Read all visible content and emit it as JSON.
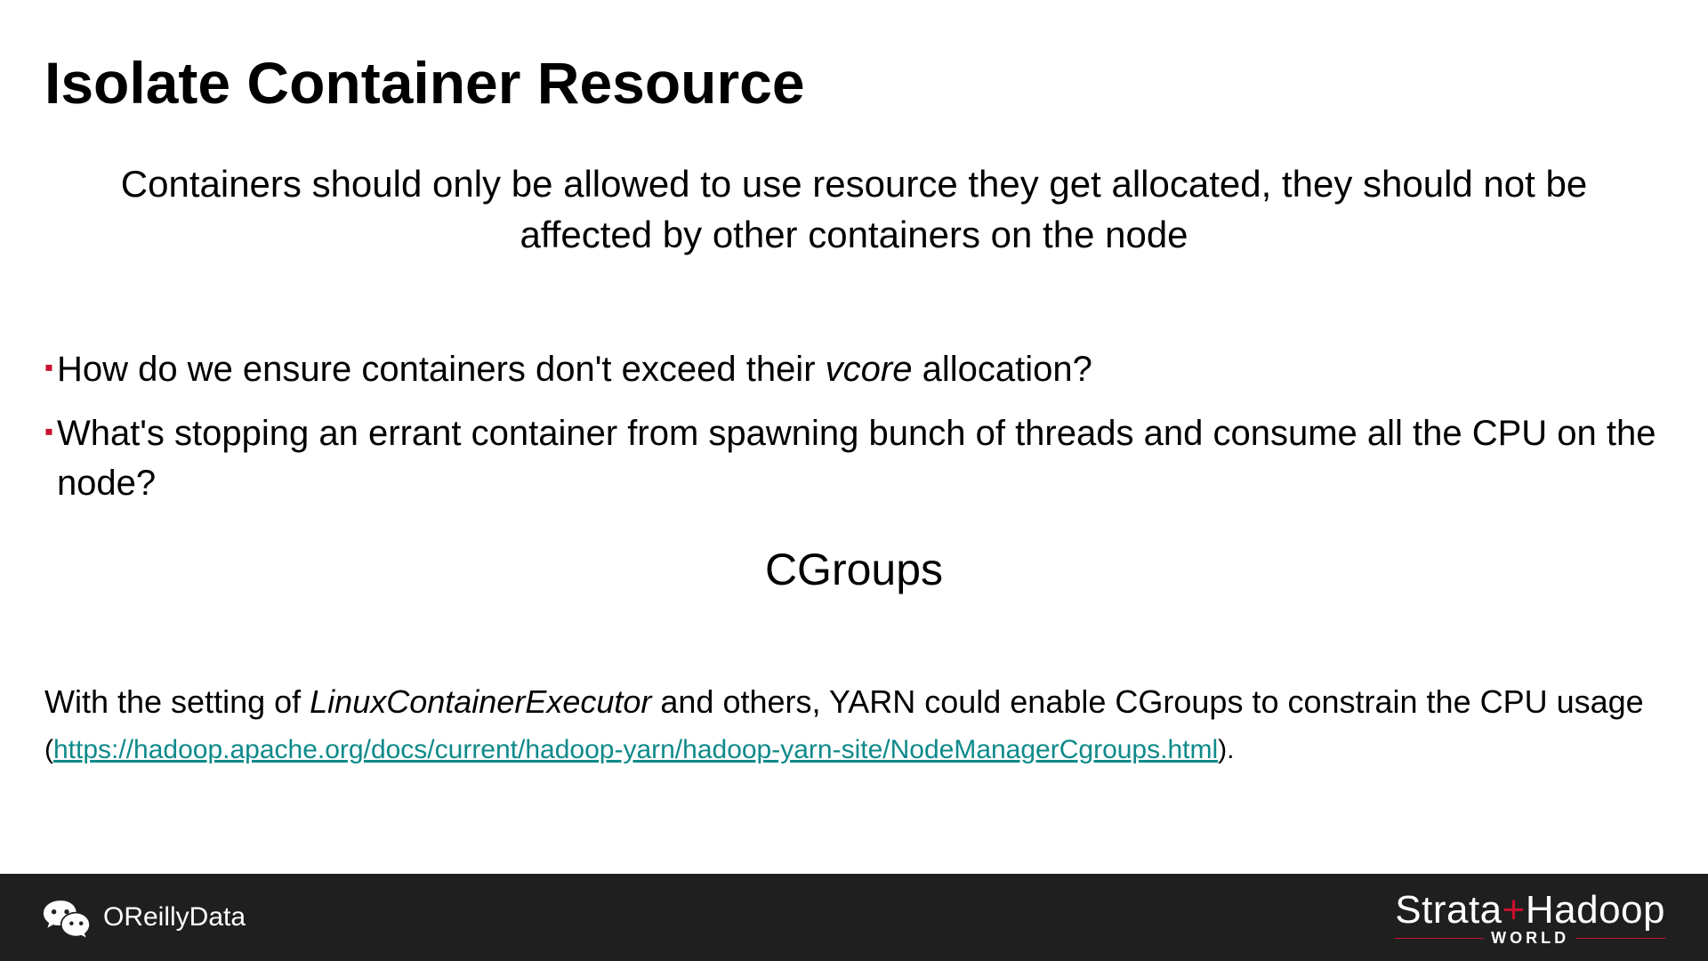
{
  "title": "Isolate Container Resource",
  "subtitle": "Containers should only be allowed to use resource they get allocated, they should not be affected by other containers on the node",
  "bullets": [
    {
      "pre": "How do we ensure containers don't exceed their ",
      "italic": "vcore",
      "post": " allocation?"
    },
    {
      "pre": "What's stopping an errant container from spawning bunch of threads and consume all the CPU on the node?",
      "italic": "",
      "post": ""
    }
  ],
  "cgroups": "CGroups",
  "footnote": {
    "pre": "With the setting of ",
    "italic": "LinuxContainerExecutor",
    "mid": " and others, YARN could enable CGroups to constrain the CPU usage ",
    "paren_open": "(",
    "link": "https://hadoop.apache.org/docs/current/hadoop-yarn/hadoop-yarn-site/NodeManagerCgroups.html",
    "paren_close": ").",
    "link_href": "https://hadoop.apache.org/docs/current/hadoop-yarn/hadoop-yarn-site/NodeManagerCgroups.html"
  },
  "footer": {
    "left": "OReillyData",
    "brand_a": "Strata",
    "brand_plus": "+",
    "brand_b": "Hadoop",
    "brand_sub": "WORLD"
  }
}
